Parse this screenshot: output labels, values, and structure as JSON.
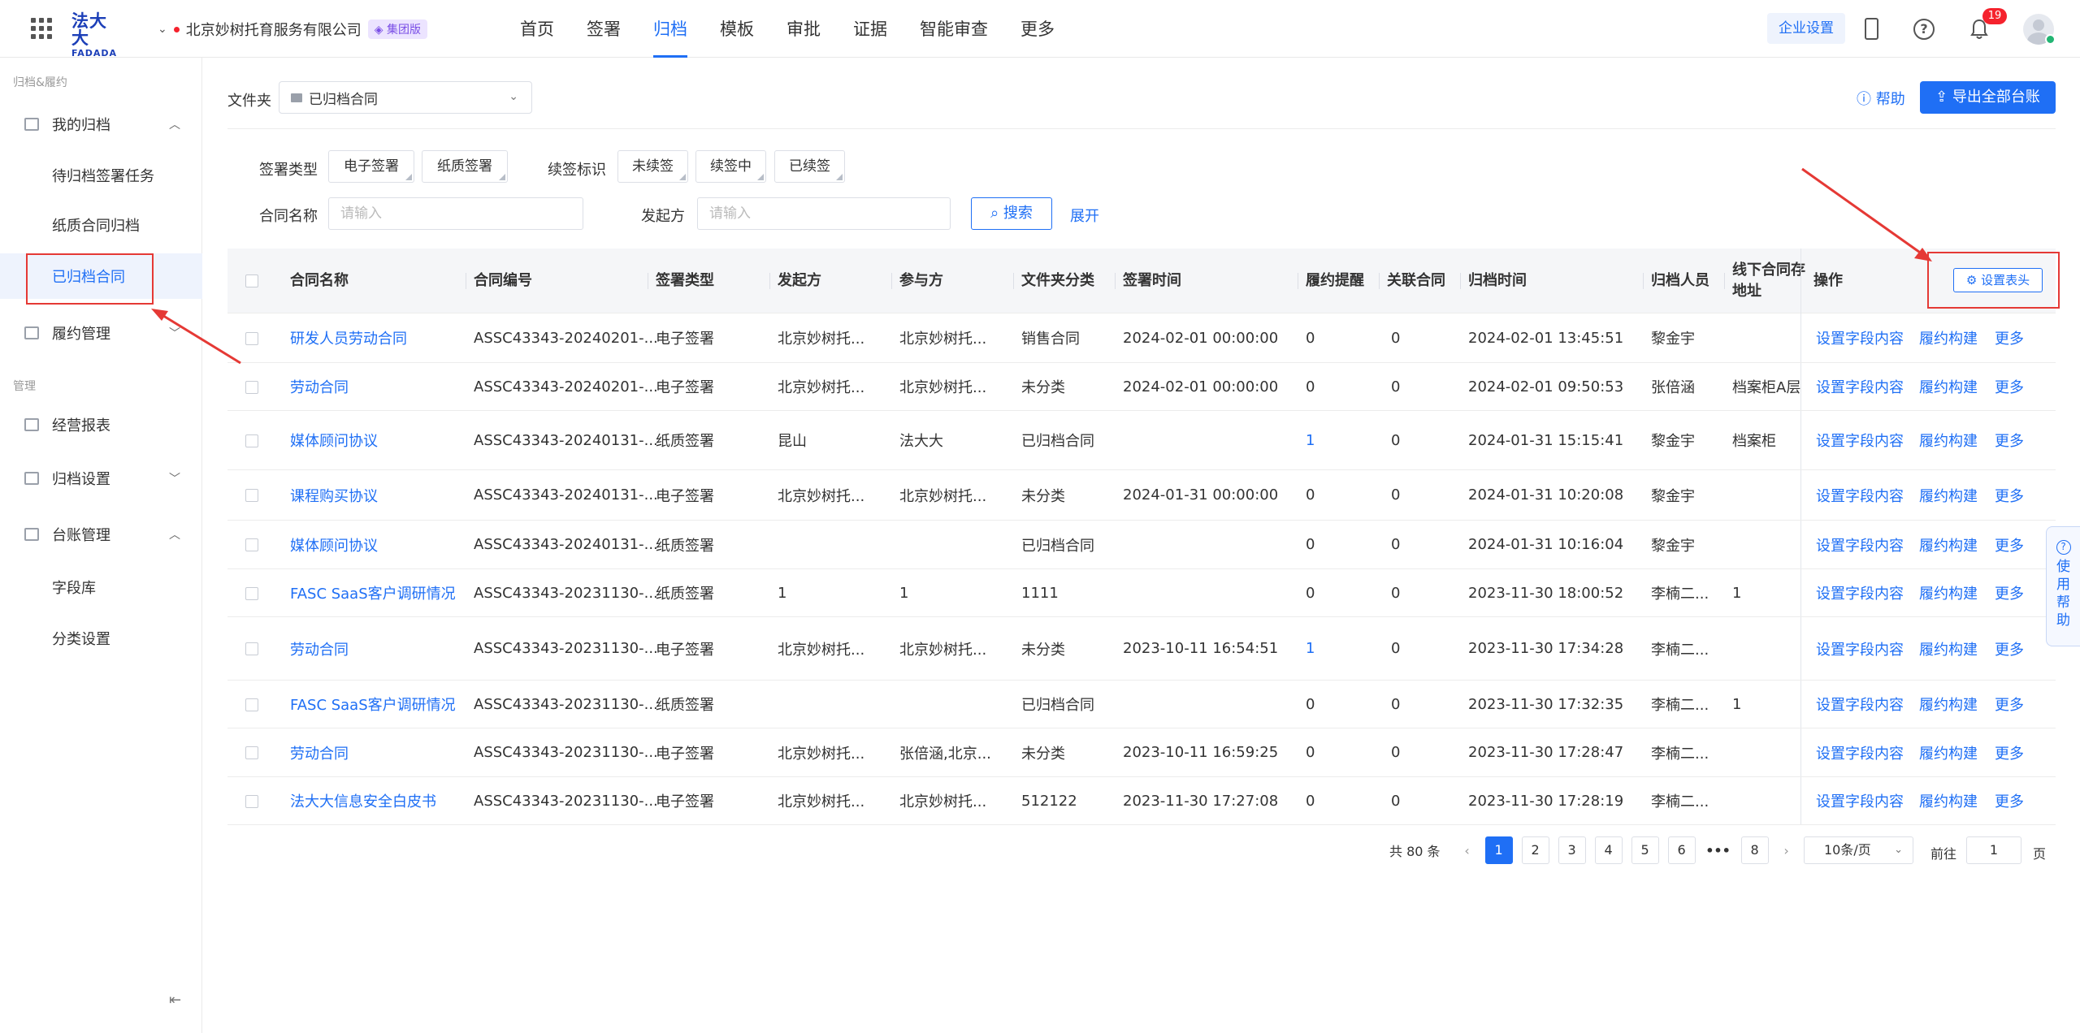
{
  "topbar": {
    "logo_main": "法大大",
    "logo_sub": "FADADA",
    "org_name": "北京妙树托育服务有限公司",
    "org_badge": "集团版",
    "nav": [
      "首页",
      "签署",
      "归档",
      "模板",
      "审批",
      "证据",
      "智能审查",
      "更多"
    ],
    "active_nav": "归档",
    "corp_settings": "企业设置",
    "notification_count": "19"
  },
  "sidebar": {
    "group1": "归档&履约",
    "group2": "管理",
    "items": {
      "my_archive": "我的归档",
      "pending": "待归档签署任务",
      "paper": "纸质合同归档",
      "archived": "已归档合同",
      "fulfill": "履约管理",
      "report": "经营报表",
      "archive_settings": "归档设置",
      "ledger": "台账管理",
      "field_lib": "字段库",
      "category": "分类设置"
    }
  },
  "toolbar": {
    "folder_label": "文件夹",
    "folder_value": "已归档合同",
    "help": "帮助",
    "export": "导出全部台账"
  },
  "filters": {
    "sign_type_label": "签署类型",
    "sign_types": [
      "电子签署",
      "纸质签署"
    ],
    "renew_label": "续签标识",
    "renew_tags": [
      "未续签",
      "续签中",
      "已续签"
    ],
    "name_label": "合同名称",
    "name_placeholder": "请输入",
    "initiator_label": "发起方",
    "initiator_placeholder": "请输入",
    "search": "搜索",
    "expand": "展开"
  },
  "table": {
    "headers": {
      "name": "合同名称",
      "code": "合同编号",
      "sign_type": "签署类型",
      "initiator": "发起方",
      "participant": "参与方",
      "folder_cat": "文件夹分类",
      "sign_time": "签署时间",
      "remind": "履约提醒",
      "related": "关联合同",
      "archive_time": "归档时间",
      "archiver": "归档人员",
      "offline_line1": "线下合同存",
      "offline_line2": "地址",
      "ops": "操作",
      "set_header": "设置表头"
    },
    "op_labels": [
      "设置字段内容",
      "履约构建",
      "更多"
    ],
    "rows": [
      {
        "name": "研发人员劳动合同",
        "code": "ASSC43343-20240201-...",
        "sign_type": "电子签署",
        "initiator": "北京妙树托...",
        "participant": "北京妙树托...",
        "folder_cat": "销售合同",
        "sign_time": "2024-02-01 00:00:00",
        "remind": "0",
        "related": "0",
        "archive_time": "2024-02-01 13:45:51",
        "archiver": "黎金宇",
        "offline": ""
      },
      {
        "name": "劳动合同",
        "code": "ASSC43343-20240201-...",
        "sign_type": "电子签署",
        "initiator": "北京妙树托...",
        "participant": "北京妙树托...",
        "folder_cat": "未分类",
        "sign_time": "2024-02-01 00:00:00",
        "remind": "0",
        "related": "0",
        "archive_time": "2024-02-01 09:50:53",
        "archiver": "张倍涵",
        "offline": "档案柜A层"
      },
      {
        "name": "媒体顾问协议",
        "code": "ASSC43343-20240131-...",
        "sign_type": "纸质签署",
        "initiator": "昆山",
        "participant": "法大大",
        "folder_cat": "已归档合同",
        "sign_time": "",
        "remind": "1",
        "related": "0",
        "archive_time": "2024-01-31 15:15:41",
        "archiver": "黎金宇",
        "offline": "档案柜"
      },
      {
        "name": "课程购买协议",
        "code": "ASSC43343-20240131-...",
        "sign_type": "电子签署",
        "initiator": "北京妙树托...",
        "participant": "北京妙树托...",
        "folder_cat": "未分类",
        "sign_time": "2024-01-31 00:00:00",
        "remind": "0",
        "related": "0",
        "archive_time": "2024-01-31 10:20:08",
        "archiver": "黎金宇",
        "offline": ""
      },
      {
        "name": "媒体顾问协议",
        "code": "ASSC43343-20240131-...",
        "sign_type": "纸质签署",
        "initiator": "",
        "participant": "",
        "folder_cat": "已归档合同",
        "sign_time": "",
        "remind": "0",
        "related": "0",
        "archive_time": "2024-01-31 10:16:04",
        "archiver": "黎金宇",
        "offline": ""
      },
      {
        "name": "FASC SaaS客户调研情况",
        "code": "ASSC43343-20231130-...",
        "sign_type": "纸质签署",
        "initiator": "1",
        "participant": "1",
        "folder_cat": "1111",
        "sign_time": "",
        "remind": "0",
        "related": "0",
        "archive_time": "2023-11-30 18:00:52",
        "archiver": "李楠二...",
        "offline": "1"
      },
      {
        "name": "劳动合同",
        "code": "ASSC43343-20231130-...",
        "sign_type": "电子签署",
        "initiator": "北京妙树托...",
        "participant": "北京妙树托...",
        "folder_cat": "未分类",
        "sign_time": "2023-10-11 16:54:51",
        "remind": "1",
        "related": "0",
        "archive_time": "2023-11-30 17:34:28",
        "archiver": "李楠二...",
        "offline": ""
      },
      {
        "name": "FASC SaaS客户调研情况",
        "code": "ASSC43343-20231130-...",
        "sign_type": "纸质签署",
        "initiator": "",
        "participant": "",
        "folder_cat": "已归档合同",
        "sign_time": "",
        "remind": "0",
        "related": "0",
        "archive_time": "2023-11-30 17:32:35",
        "archiver": "李楠二...",
        "offline": "1"
      },
      {
        "name": "劳动合同",
        "code": "ASSC43343-20231130-...",
        "sign_type": "电子签署",
        "initiator": "北京妙树托...",
        "participant": "张倍涵,北京...",
        "folder_cat": "未分类",
        "sign_time": "2023-10-11 16:59:25",
        "remind": "0",
        "related": "0",
        "archive_time": "2023-11-30 17:28:47",
        "archiver": "李楠二...",
        "offline": ""
      },
      {
        "name": "法大大信息安全白皮书",
        "code": "ASSC43343-20231130-...",
        "sign_type": "电子签署",
        "initiator": "北京妙树托...",
        "participant": "北京妙树托...",
        "folder_cat": "512122",
        "sign_time": "2023-11-30 17:27:08",
        "remind": "0",
        "related": "0",
        "archive_time": "2023-11-30 17:28:19",
        "archiver": "李楠二...",
        "offline": ""
      }
    ]
  },
  "pagination": {
    "total": "共 80 条",
    "pages": [
      "1",
      "2",
      "3",
      "4",
      "5",
      "6"
    ],
    "ellipsis": "•••",
    "last": "8",
    "current": "1",
    "page_size": "10条/页",
    "goto_label": "前往",
    "goto_value": "1",
    "goto_suffix": "页"
  },
  "help_float": [
    "使",
    "用",
    "帮",
    "助"
  ]
}
